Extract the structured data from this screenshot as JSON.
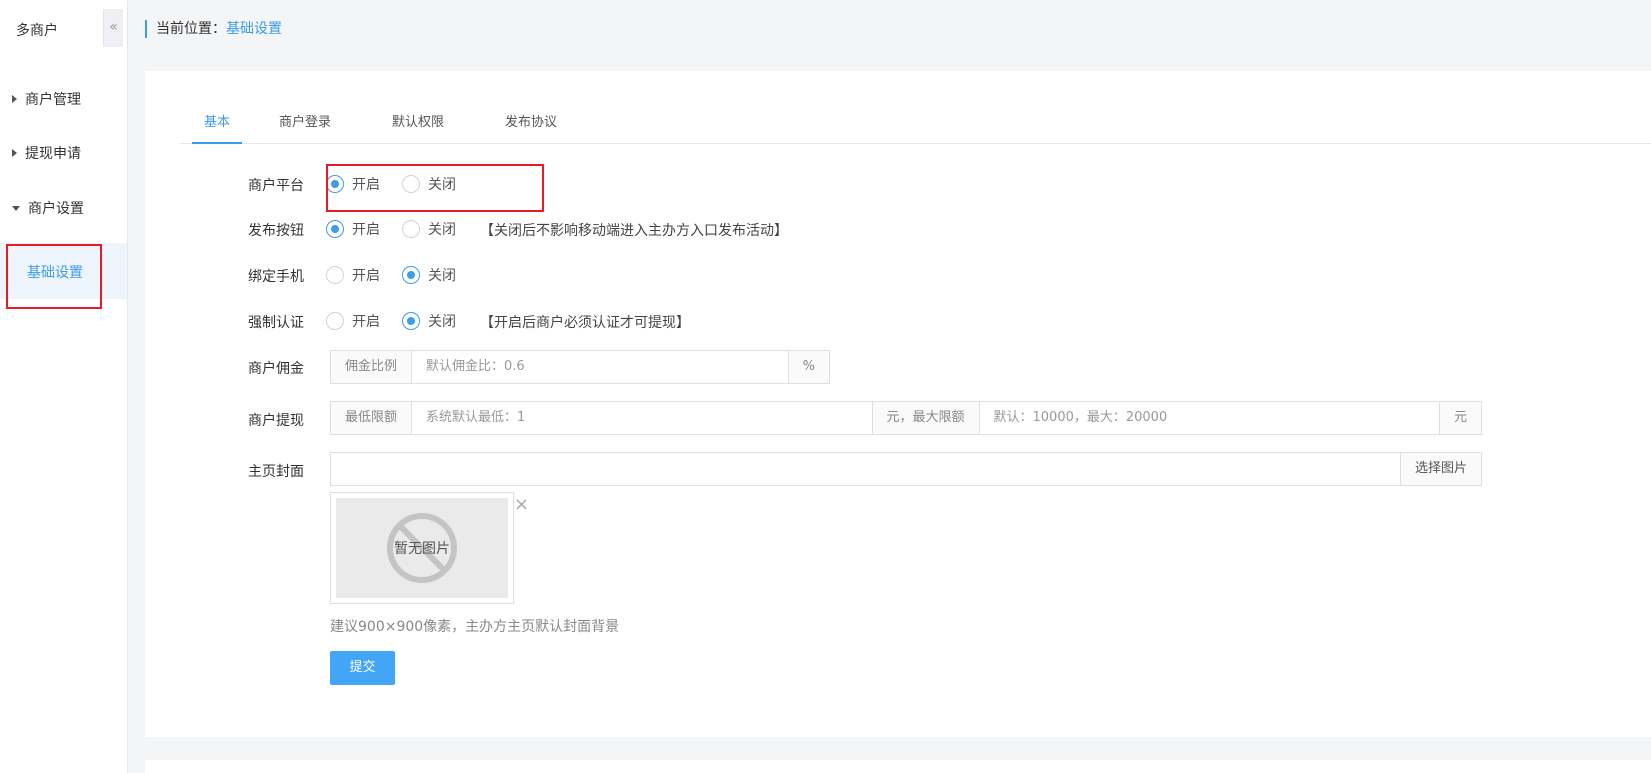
{
  "sidebar": {
    "title": "多商户",
    "collapse_icon": "«",
    "items": [
      {
        "label": "商户管理"
      },
      {
        "label": "提现申请"
      },
      {
        "label": "商户设置"
      }
    ],
    "sub_item": "基础设置"
  },
  "breadcrumb": {
    "prefix": "当前位置：",
    "current": "基础设置"
  },
  "tabs": [
    {
      "label": "基本",
      "active": true
    },
    {
      "label": "商户登录"
    },
    {
      "label": "默认权限"
    },
    {
      "label": "发布协议"
    }
  ],
  "form": {
    "merchant_platform": {
      "label": "商户平台",
      "on": "开启",
      "off": "关闭",
      "selected": "on"
    },
    "publish_button": {
      "label": "发布按钮",
      "on": "开启",
      "off": "关闭",
      "selected": "on",
      "note": "【关闭后不影响移动端进入主办方入口发布活动】"
    },
    "bind_phone": {
      "label": "绑定手机",
      "on": "开启",
      "off": "关闭",
      "selected": "off"
    },
    "force_auth": {
      "label": "强制认证",
      "on": "开启",
      "off": "关闭",
      "selected": "off",
      "note": "【开启后商户必须认证才可提现】"
    },
    "commission": {
      "label": "商户佣金",
      "addon": "佣金比例",
      "placeholder": "默认佣金比：0.6",
      "suffix": "%"
    },
    "withdraw": {
      "label": "商户提现",
      "addon_min": "最低限额",
      "placeholder_min": "系统默认最低：1",
      "addon_max": "元，最大限额",
      "placeholder_max": "默认：10000，最大：20000",
      "suffix": "元"
    },
    "cover": {
      "label": "主页封面",
      "value": "",
      "button": "选择图片",
      "no_image": "暂无图片",
      "close": "×",
      "hint": "建议900×900像素，主办方主页默认封面背景"
    },
    "submit": "提交"
  },
  "colors": {
    "accent": "#3d9be9",
    "highlight": "#e51c23",
    "button": "#42a5f5"
  }
}
